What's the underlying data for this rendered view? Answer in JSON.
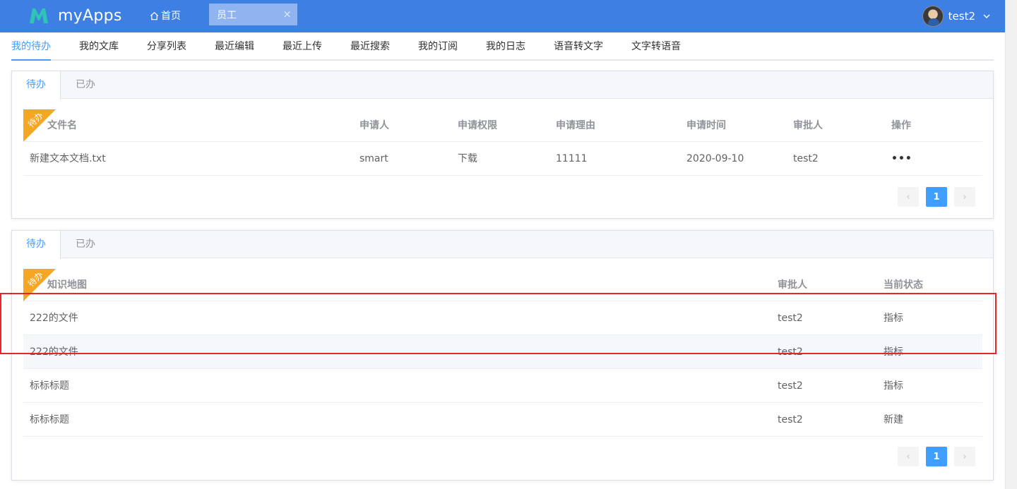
{
  "header": {
    "app_name": "myApps",
    "home_label": "首页",
    "open_tab_label": "员工",
    "open_tab_close": "×",
    "user_name": "test2",
    "icons": {
      "logo": "myapps-logo-icon",
      "home": "home-icon",
      "close": "close-icon",
      "dropdown": "chevron-down-icon"
    },
    "colors": {
      "bar": "#3d7fe2",
      "logo": "#2ec5b6"
    }
  },
  "nav": {
    "tabs": [
      "我的待办",
      "我的文库",
      "分享列表",
      "最近编辑",
      "最近上传",
      "最近搜索",
      "我的订阅",
      "我的日志",
      "语音转文字",
      "文字转语音"
    ],
    "active": "我的待办"
  },
  "panel1": {
    "tabs": [
      "待办",
      "已办"
    ],
    "badge": "待办",
    "columns": [
      "文件名",
      "申请人",
      "申请权限",
      "申请理由",
      "申请时间",
      "审批人",
      "操作"
    ],
    "rows": [
      [
        "新建文本文档.txt",
        "smart",
        "下载",
        "11111",
        "2020-09-10",
        "test2",
        "•••"
      ]
    ],
    "pagination": {
      "prev": "‹",
      "page": "1",
      "next": "›"
    }
  },
  "panel2": {
    "tabs": [
      "待办",
      "已办"
    ],
    "badge": "待办",
    "columns": [
      "知识地图",
      "审批人",
      "当前状态"
    ],
    "rows": [
      [
        "222的文件",
        "test2",
        "指标"
      ],
      [
        "222的文件",
        "test2",
        "指标"
      ],
      [
        "标标标题",
        "test2",
        "指标"
      ],
      [
        "标标标题",
        "test2",
        "新建"
      ]
    ],
    "pagination": {
      "prev": "‹",
      "page": "1",
      "next": "›"
    }
  },
  "theme": {
    "accent": "#409eff",
    "badge": "#f5a623",
    "annotation": "#e8262a"
  }
}
